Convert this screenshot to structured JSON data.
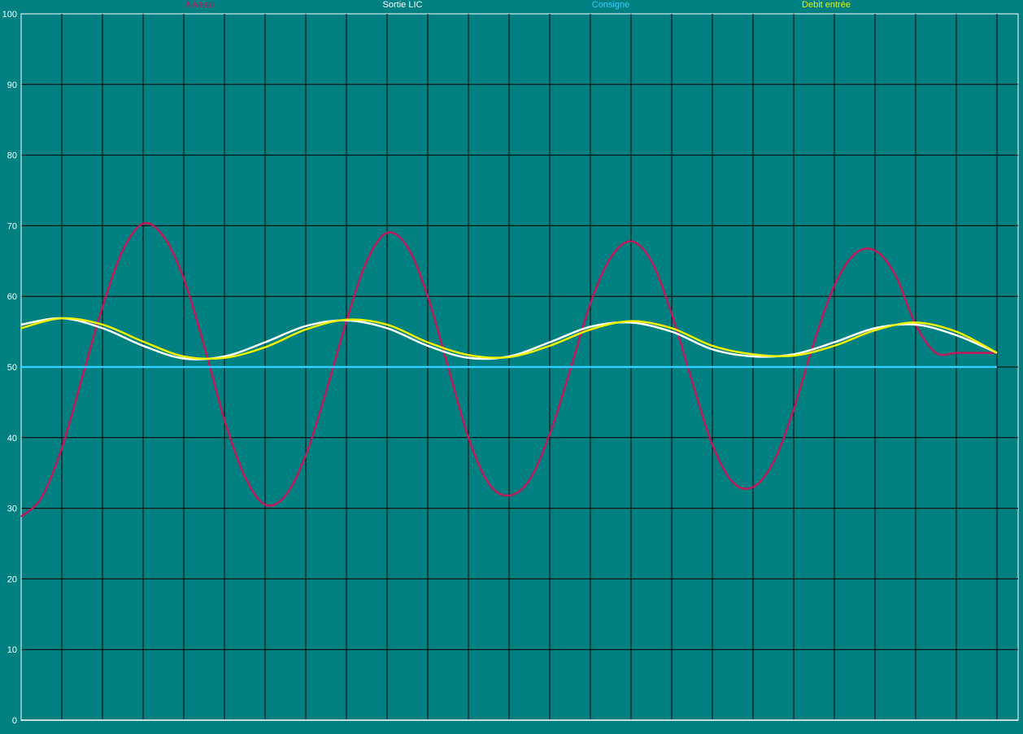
{
  "chart_data": {
    "type": "line",
    "title": "",
    "xlabel": "",
    "ylabel": "",
    "ylim": [
      0,
      100
    ],
    "xlim": [
      0,
      24
    ],
    "y_ticks": [
      "0",
      "10",
      "20",
      "30",
      "40",
      "50",
      "60",
      "70",
      "80",
      "90",
      "100"
    ],
    "grid": true,
    "legend_position": "top",
    "colors": {
      "background": "#008080",
      "grid": "#000000",
      "axis": "#ffffff"
    },
    "series": [
      {
        "name": "Niveau",
        "color": "#c0185a",
        "x": [
          0,
          0.5,
          1,
          1.5,
          2,
          2.5,
          3,
          3.5,
          4,
          4.5,
          5,
          5.5,
          6,
          6.5,
          7,
          7.5,
          8,
          8.5,
          9,
          9.5,
          10,
          10.5,
          11,
          11.5,
          12,
          12.5,
          13,
          13.5,
          14,
          14.5,
          15,
          15.5,
          16,
          16.5,
          17,
          17.5,
          18,
          18.5,
          19,
          19.5,
          20,
          20.5,
          21,
          21.5,
          22,
          22.5,
          23,
          23.5,
          24
        ],
        "values": [
          28.8,
          31.5,
          38.5,
          48.5,
          58.5,
          66.5,
          70.3,
          68.5,
          62.5,
          53.0,
          42.5,
          34.5,
          30.5,
          31.8,
          37.5,
          46.5,
          56.5,
          65.0,
          69.0,
          67.0,
          60.0,
          50.0,
          40.0,
          33.5,
          31.8,
          34.0,
          40.5,
          49.5,
          59.0,
          65.5,
          67.8,
          65.0,
          57.5,
          48.0,
          39.0,
          33.7,
          33.0,
          36.5,
          44.0,
          53.5,
          61.5,
          66.0,
          66.5,
          63.0,
          56.0,
          52.0,
          52.0,
          52.0,
          52.0
        ]
      },
      {
        "name": "Sortie LIC",
        "color": "#ffffff",
        "x": [
          0,
          1,
          2,
          3,
          4,
          5,
          6,
          7,
          8,
          9,
          10,
          11,
          12,
          13,
          14,
          15,
          16,
          17,
          18,
          19,
          20,
          21,
          22,
          23,
          24
        ],
        "values": [
          56.0,
          56.9,
          55.5,
          53.0,
          51.2,
          51.5,
          53.5,
          55.8,
          56.6,
          55.5,
          53.0,
          51.3,
          51.5,
          53.5,
          55.7,
          56.3,
          55.0,
          52.5,
          51.5,
          51.8,
          53.5,
          55.5,
          56.0,
          54.5,
          52.0
        ]
      },
      {
        "name": "Consigne",
        "color": "#33ccff",
        "x": [
          0,
          24
        ],
        "values": [
          50,
          50
        ]
      },
      {
        "name": "Debit entrée",
        "color": "#f0f000",
        "x": [
          0,
          1,
          2,
          3,
          4,
          5,
          6,
          7,
          8,
          9,
          10,
          11,
          12,
          13,
          14,
          15,
          16,
          17,
          18,
          19,
          20,
          21,
          22,
          23,
          24
        ],
        "values": [
          55.5,
          56.9,
          56.0,
          53.6,
          51.5,
          51.3,
          52.8,
          55.3,
          56.7,
          56.0,
          53.5,
          51.7,
          51.4,
          53.0,
          55.3,
          56.5,
          55.5,
          53.0,
          51.8,
          51.6,
          53.0,
          55.2,
          56.3,
          55.0,
          52.0
        ]
      }
    ]
  }
}
